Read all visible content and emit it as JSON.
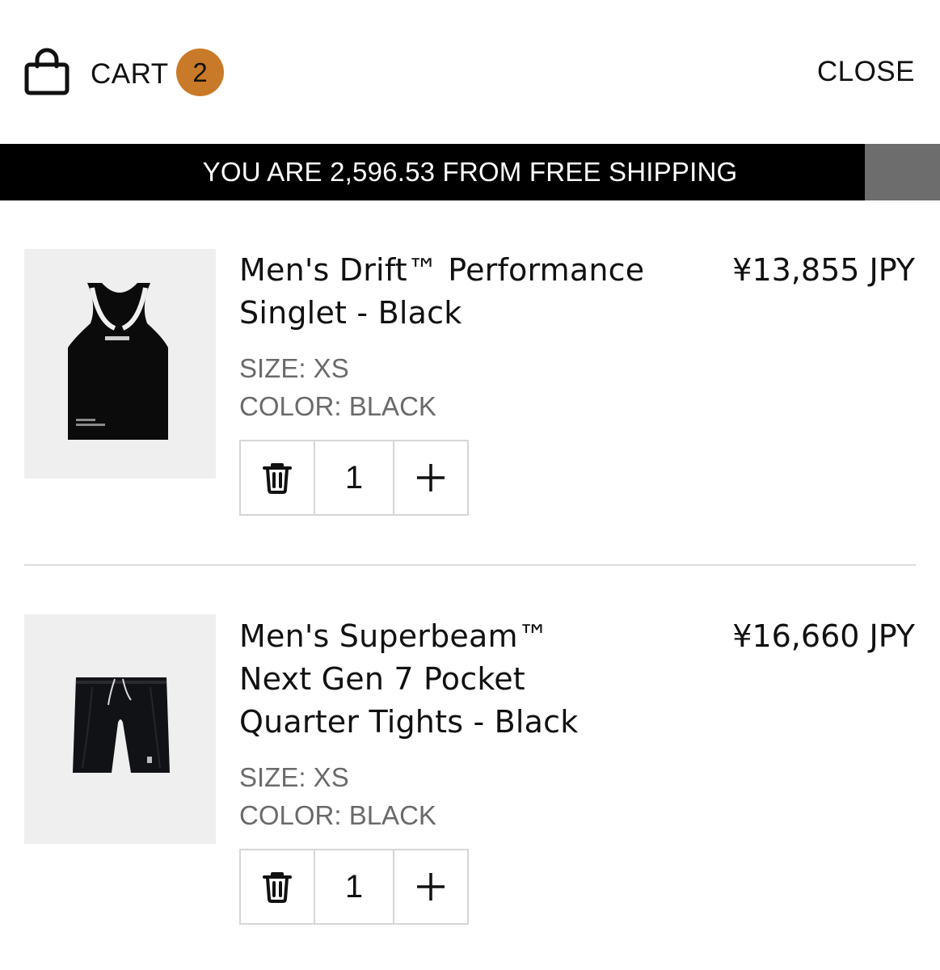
{
  "header": {
    "cart_label": "CART",
    "cart_count": "2",
    "close_label": "CLOSE",
    "icon": "shopping-bag-icon",
    "badge_color": "#c97a28"
  },
  "shipping_bar": {
    "message": "YOU ARE 2,596.53 FROM FREE SHIPPING",
    "progress_fraction": 0.92
  },
  "items": [
    {
      "name_line1": "Men's Drift™ Performance",
      "name_line2": "Singlet - Black",
      "name_line3": "",
      "price": "¥13,855 JPY",
      "size": "SIZE: XS",
      "color": "COLOR: BLACK",
      "quantity": "1",
      "remove_icon": "trash-icon",
      "add_icon": "plus-icon"
    },
    {
      "name_line1": "Men's Superbeam™",
      "name_line2": "Next Gen 7 Pocket",
      "name_line3": "Quarter Tights - Black",
      "price": "¥16,660 JPY",
      "size": "SIZE: XS",
      "color": "COLOR: BLACK",
      "quantity": "1",
      "remove_icon": "trash-icon",
      "add_icon": "plus-icon"
    }
  ]
}
